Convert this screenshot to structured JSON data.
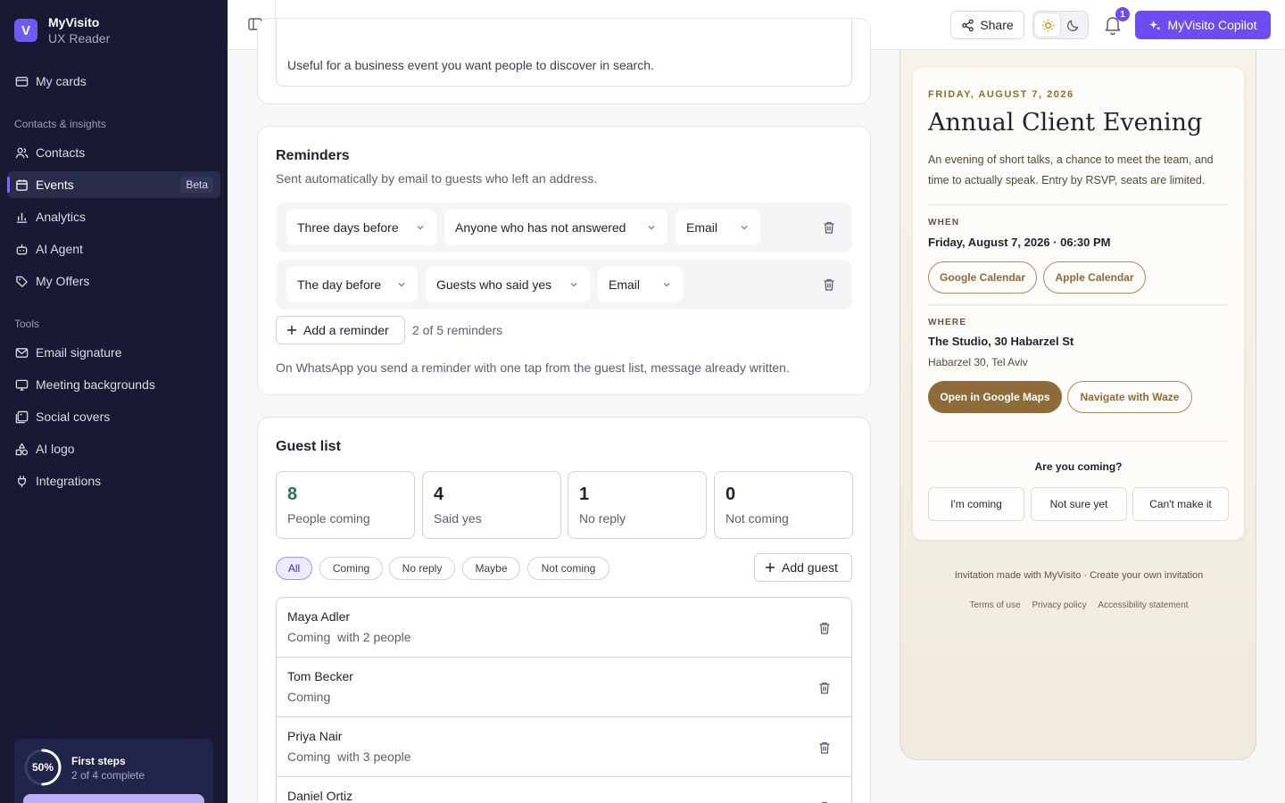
{
  "brand": {
    "name": "MyVisito",
    "sub": "UX Reader",
    "logo_letter": "V"
  },
  "sidebar": {
    "top_items": [
      {
        "label": "My cards",
        "icon": "card-icon"
      }
    ],
    "section_contacts": "Contacts & insights",
    "contact_items": [
      {
        "label": "Contacts",
        "icon": "users-icon"
      },
      {
        "label": "Events",
        "icon": "calendar-icon",
        "badge": "Beta",
        "active": true
      },
      {
        "label": "Analytics",
        "icon": "bar-chart-icon"
      },
      {
        "label": "AI Agent",
        "icon": "robot-icon"
      },
      {
        "label": "My Offers",
        "icon": "tag-icon"
      }
    ],
    "section_tools": "Tools",
    "tool_items": [
      {
        "label": "Email signature",
        "icon": "mail-icon"
      },
      {
        "label": "Meeting backgrounds",
        "icon": "monitor-icon"
      },
      {
        "label": "Social covers",
        "icon": "image-icon"
      },
      {
        "label": "AI logo",
        "icon": "shapes-icon"
      },
      {
        "label": "Integrations",
        "icon": "plug-icon"
      }
    ],
    "progress": {
      "percent_label": "50%",
      "fraction": 0.5,
      "title": "First steps",
      "sub": "2 of 4 complete"
    }
  },
  "topbar": {
    "share": "Share",
    "notifications_count": "1",
    "copilot": "MyVisito Copilot"
  },
  "listing": {
    "desc": "Useful for a business event you want people to discover in search."
  },
  "reminders": {
    "title": "Reminders",
    "sub": "Sent automatically by email to guests who left an address.",
    "rows": [
      {
        "when": "Three days before",
        "who": "Anyone who has not answered",
        "channel": "Email"
      },
      {
        "when": "The day before",
        "who": "Guests who said yes",
        "channel": "Email"
      }
    ],
    "add_label": "Add a reminder",
    "count": "2 of 5 reminders",
    "whatsapp_note": "On WhatsApp you send a reminder with one tap from the guest list, message already written."
  },
  "guests": {
    "title": "Guest list",
    "stats": [
      {
        "num": "8",
        "label": "People coming"
      },
      {
        "num": "4",
        "label": "Said yes"
      },
      {
        "num": "1",
        "label": "No reply"
      },
      {
        "num": "0",
        "label": "Not coming"
      }
    ],
    "filters": [
      "All",
      "Coming",
      "No reply",
      "Maybe",
      "Not coming"
    ],
    "add_guest": "Add guest",
    "rows": [
      {
        "name": "Maya Adler",
        "status": "Coming  with 2 people"
      },
      {
        "name": "Tom Becker",
        "status": "Coming"
      },
      {
        "name": "Priya Nair",
        "status": "Coming  with 3 people"
      },
      {
        "name": "Daniel Ortiz",
        "status": ""
      }
    ]
  },
  "invite": {
    "date": "FRIDAY, AUGUST 7, 2026",
    "title": "Annual Client Evening",
    "desc": "An evening of short talks, a chance to meet the team, and time to actually speak. Entry by RSVP, seats are limited.",
    "when_label": "WHEN",
    "when_value": "Friday, August 7, 2026 · 06:30 PM",
    "google_cal": "Google Calendar",
    "apple_cal": "Apple Calendar",
    "where_label": "WHERE",
    "where_value": "The Studio, 30 Habarzel St",
    "where_sub": "Habarzel 30, Tel Aviv",
    "maps": "Open in Google Maps",
    "waze": "Navigate with Waze",
    "rsvp_q": "Are you coming?",
    "rsvp": [
      "I'm coming",
      "Not sure yet",
      "Can't make it"
    ],
    "footer": "Invitation made with MyVisito · Create your own invitation",
    "links": [
      "Terms of use",
      "Privacy policy",
      "Accessibility statement"
    ]
  },
  "colors": {
    "sidebar": "#181a33",
    "accent": "#6d4df2",
    "gold": "#8f6b3a",
    "green": "#1e7a4f"
  }
}
